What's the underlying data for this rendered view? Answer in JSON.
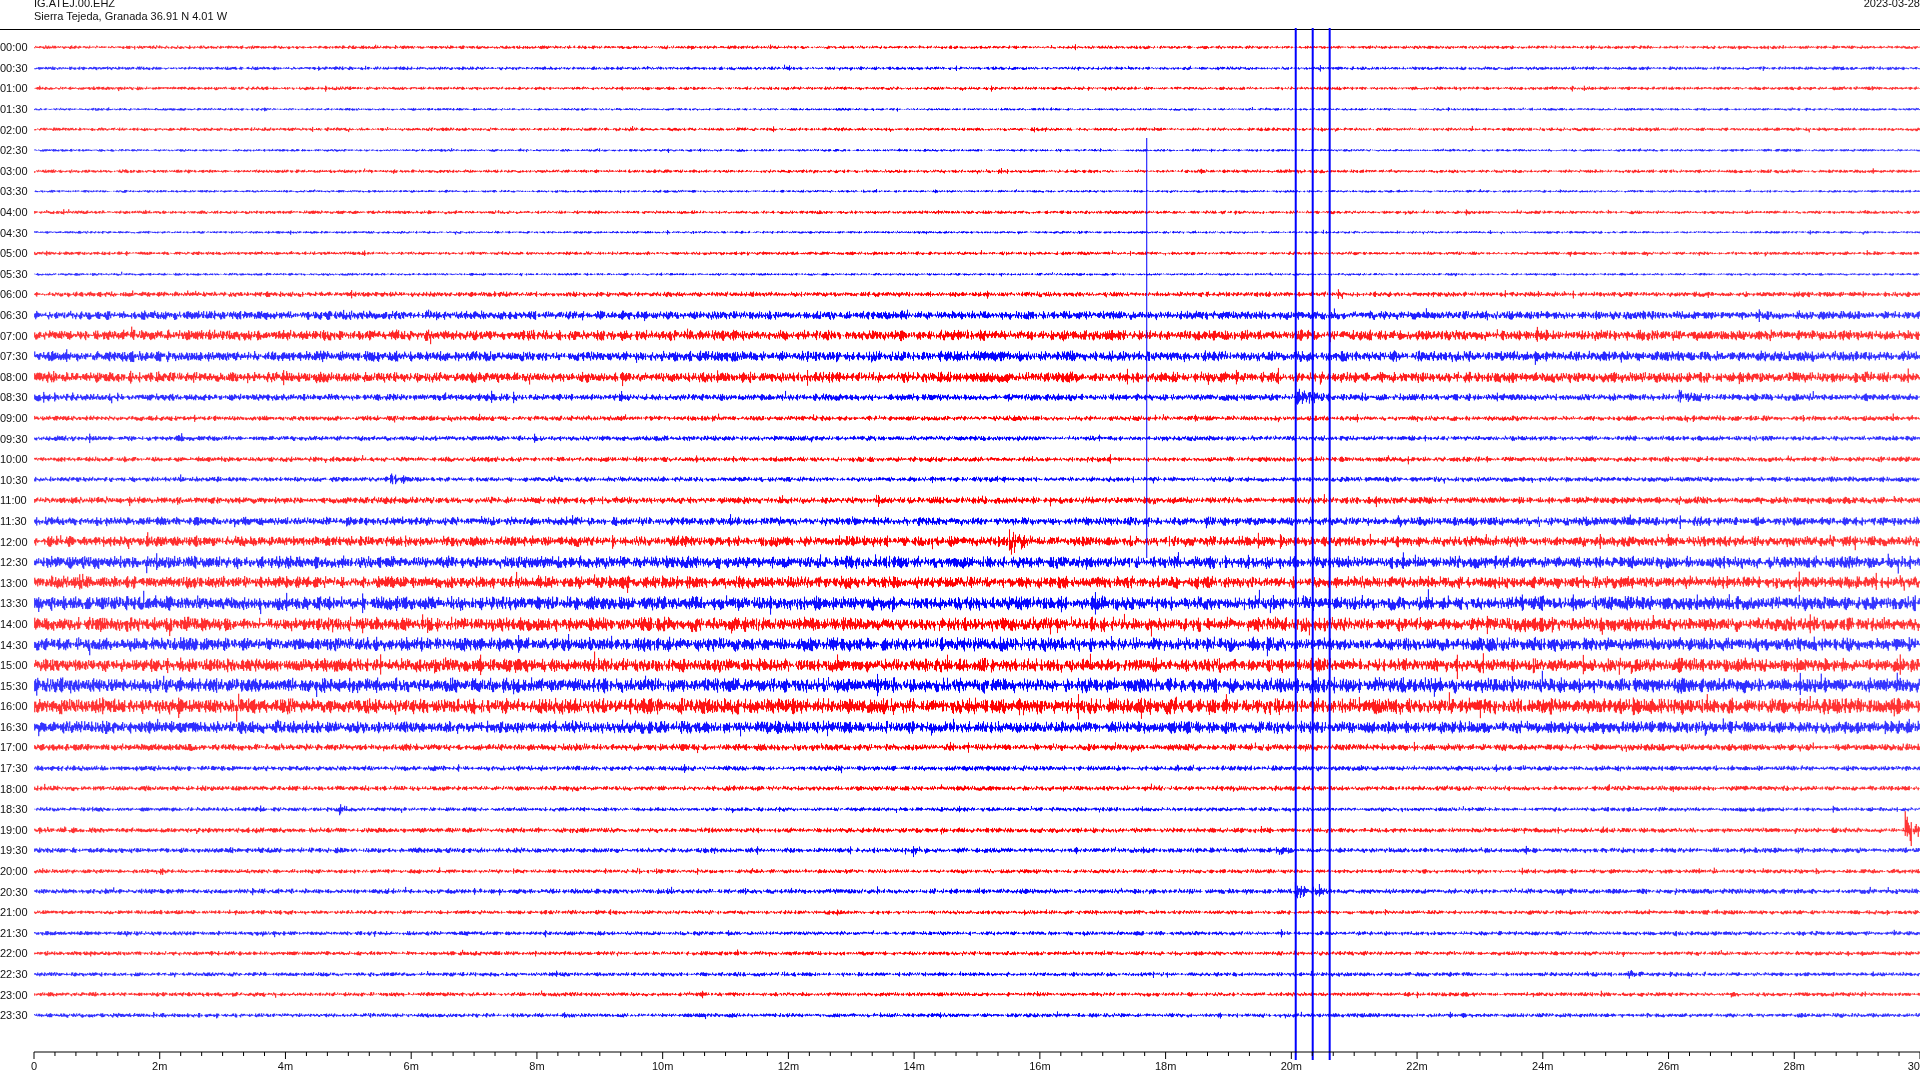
{
  "header": {
    "station": "IG.ATEJ.00.EHZ",
    "location": "Sierra Tejeda, Granada  36.91 N 4.01 W",
    "date": "2023-03-28"
  },
  "rows": [
    {
      "time": "00:00",
      "color": "#ff0000"
    },
    {
      "time": "00:30",
      "color": "#0000ff"
    },
    {
      "time": "01:00",
      "color": "#ff0000"
    },
    {
      "time": "01:30",
      "color": "#0000ff"
    },
    {
      "time": "02:00",
      "color": "#ff0000"
    },
    {
      "time": "02:30",
      "color": "#0000ff"
    },
    {
      "time": "03:00",
      "color": "#ff0000"
    },
    {
      "time": "03:30",
      "color": "#0000ff"
    },
    {
      "time": "04:00",
      "color": "#ff0000"
    },
    {
      "time": "04:30",
      "color": "#0000ff"
    },
    {
      "time": "05:00",
      "color": "#ff0000"
    },
    {
      "time": "05:30",
      "color": "#0000ff"
    },
    {
      "time": "06:00",
      "color": "#ff0000"
    },
    {
      "time": "06:30",
      "color": "#0000ff"
    },
    {
      "time": "07:00",
      "color": "#ff0000"
    },
    {
      "time": "07:30",
      "color": "#0000ff"
    },
    {
      "time": "08:00",
      "color": "#ff0000"
    },
    {
      "time": "08:30",
      "color": "#0000ff"
    },
    {
      "time": "09:00",
      "color": "#ff0000"
    },
    {
      "time": "09:30",
      "color": "#0000ff"
    },
    {
      "time": "10:00",
      "color": "#ff0000"
    },
    {
      "time": "10:30",
      "color": "#0000ff"
    },
    {
      "time": "11:00",
      "color": "#ff0000"
    },
    {
      "time": "11:30",
      "color": "#0000ff"
    },
    {
      "time": "12:00",
      "color": "#ff0000"
    },
    {
      "time": "12:30",
      "color": "#0000ff"
    },
    {
      "time": "13:00",
      "color": "#ff0000"
    },
    {
      "time": "13:30",
      "color": "#0000ff"
    },
    {
      "time": "14:00",
      "color": "#ff0000"
    },
    {
      "time": "14:30",
      "color": "#0000ff"
    },
    {
      "time": "15:00",
      "color": "#ff0000"
    },
    {
      "time": "15:30",
      "color": "#0000ff"
    },
    {
      "time": "16:00",
      "color": "#ff0000"
    },
    {
      "time": "16:30",
      "color": "#0000ff"
    },
    {
      "time": "17:00",
      "color": "#ff0000"
    },
    {
      "time": "17:30",
      "color": "#0000ff"
    },
    {
      "time": "18:00",
      "color": "#ff0000"
    },
    {
      "time": "18:30",
      "color": "#0000ff"
    },
    {
      "time": "19:00",
      "color": "#ff0000"
    },
    {
      "time": "19:30",
      "color": "#0000ff"
    },
    {
      "time": "20:00",
      "color": "#ff0000"
    },
    {
      "time": "20:30",
      "color": "#0000ff"
    },
    {
      "time": "21:00",
      "color": "#ff0000"
    },
    {
      "time": "21:30",
      "color": "#0000ff"
    },
    {
      "time": "22:00",
      "color": "#ff0000"
    },
    {
      "time": "22:30",
      "color": "#0000ff"
    },
    {
      "time": "23:00",
      "color": "#ff0000"
    },
    {
      "time": "23:30",
      "color": "#0000ff"
    }
  ],
  "x_axis": {
    "labels": [
      "0",
      "2m",
      "4m",
      "6m",
      "8m",
      "10m",
      "12m",
      "14m",
      "16m",
      "18m",
      "20m",
      "22m",
      "24m",
      "26m",
      "28m",
      "30"
    ]
  }
}
